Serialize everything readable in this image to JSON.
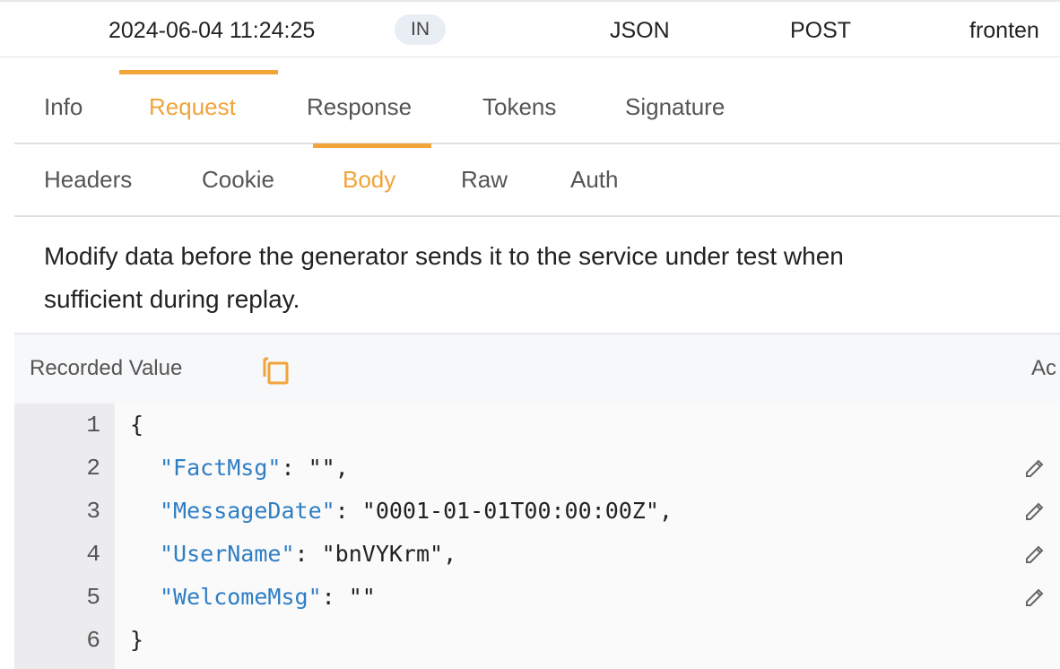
{
  "record": {
    "timestamp": "2024-06-04 11:24:25",
    "direction": "IN",
    "format": "JSON",
    "method": "POST",
    "service": "fronten"
  },
  "tabs": [
    "Info",
    "Request",
    "Response",
    "Tokens",
    "Signature"
  ],
  "active_tab": "Request",
  "subtabs": [
    "Headers",
    "Cookie",
    "Body",
    "Raw",
    "Auth"
  ],
  "active_subtab": "Body",
  "description": {
    "line1": "Modify data before the generator sends it to the service under test when",
    "line2": "sufficient during replay."
  },
  "panel": {
    "label": "Recorded Value",
    "right_label": "Ac",
    "copy_icon": "copy-icon",
    "edit_icon": "pencil-icon"
  },
  "code": {
    "line_numbers": [
      "1",
      "2",
      "3",
      "4",
      "5",
      "6"
    ],
    "open_brace": "{",
    "close_brace": "}",
    "fields": [
      {
        "key": "\"FactMsg\"",
        "rest": ": \"\","
      },
      {
        "key": "\"MessageDate\"",
        "rest": ": \"0001-01-01T00:00:00Z\","
      },
      {
        "key": "\"UserName\"",
        "rest": ": \"bnVYKrm\","
      },
      {
        "key": "\"WelcomeMsg\"",
        "rest": ": \"\""
      }
    ]
  },
  "colors": {
    "accent": "#f0a43a",
    "json_key": "#2f7ec4"
  }
}
